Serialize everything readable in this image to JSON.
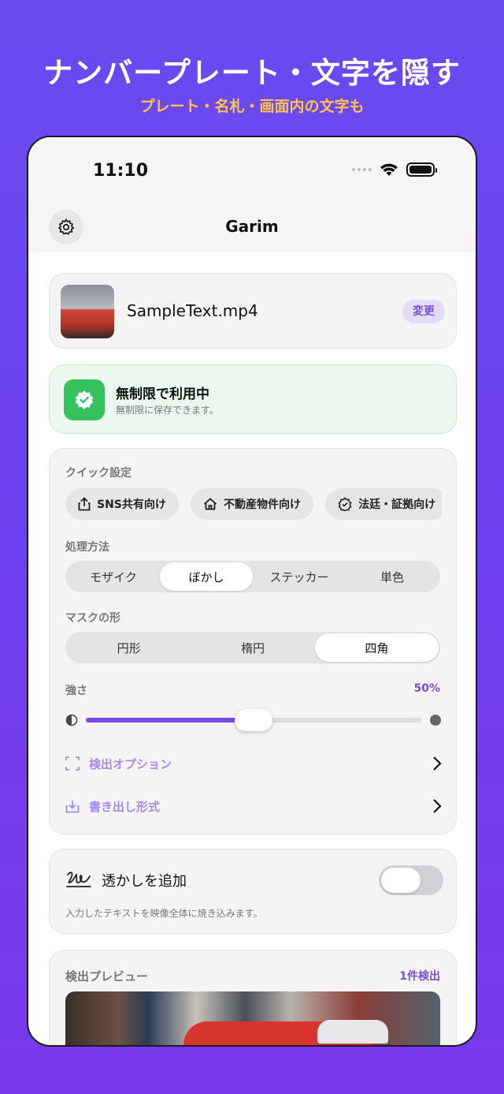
{
  "hero": {
    "title": "ナンバープレート・文字を隠す",
    "subtitle": "プレート・名札・画面内の文字も"
  },
  "status_bar": {
    "time": "11:10"
  },
  "nav": {
    "title": "Garim",
    "settings_icon": "gear-icon"
  },
  "file": {
    "name": "SampleText.mp4",
    "change_label": "変更"
  },
  "plan": {
    "title": "無制限で利用中",
    "subtitle": "無制限に保存できます。"
  },
  "quick_settings": {
    "label": "クイック設定",
    "chips": [
      "SNS共有向け",
      "不動産物件向け",
      "法廷・証拠向け"
    ]
  },
  "method": {
    "label": "処理方法",
    "options": [
      "モザイク",
      "ぼかし",
      "ステッカー",
      "単色"
    ],
    "selected": "ぼかし"
  },
  "mask_shape": {
    "label": "マスクの形",
    "options": [
      "円形",
      "楕円",
      "四角"
    ],
    "selected": "四角"
  },
  "strength": {
    "label": "強さ",
    "value_text": "50%",
    "value": 0.5
  },
  "options": {
    "detect_label": "検出オプション",
    "export_label": "書き出し形式"
  },
  "watermark": {
    "title": "透かしを追加",
    "subtitle": "入力したテキストを映像全体に焼き込みます。",
    "enabled": false
  },
  "preview": {
    "label": "検出プレビュー",
    "count": "1件検出"
  },
  "colors": {
    "accent": "#7b4ae8",
    "success": "#35c15c",
    "hero_subtitle": "#ffc34a"
  }
}
